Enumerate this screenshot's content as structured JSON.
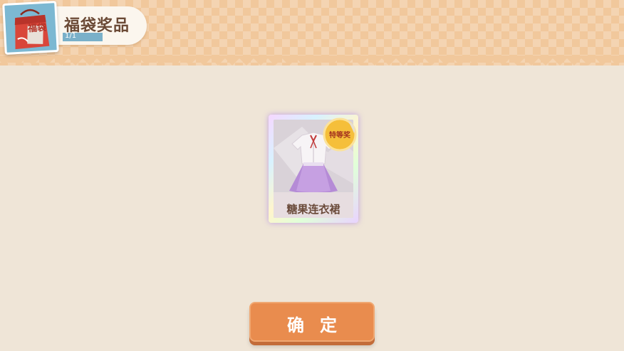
{
  "header": {
    "title": "福袋奖品",
    "progress_text": "1/1",
    "progress_value": 1.0,
    "icon": {
      "name": "lucky-bag-icon",
      "label": "福袋"
    }
  },
  "prize": {
    "name": "糖果连衣裙",
    "badge": "特等奖",
    "item_icon": "dress-icon"
  },
  "confirm_button": {
    "label": "确定"
  },
  "colors": {
    "background": "#efe5d7",
    "top_band": "#f1c89c",
    "button": "#e98c4e",
    "badge": "#f5bf3a",
    "title_text": "#6b4a36"
  }
}
